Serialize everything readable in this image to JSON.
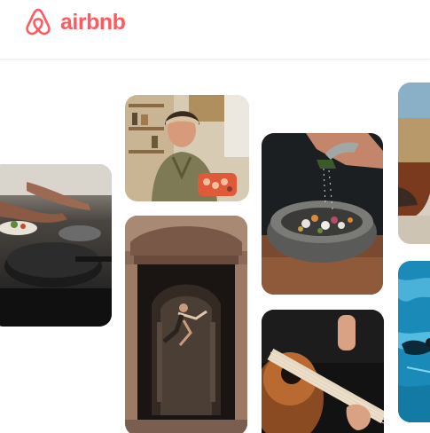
{
  "brand": {
    "name": "airbnb",
    "color": "#FF5A5F",
    "icon": "airbnb-belo-logo"
  },
  "gallery": {
    "tiles": [
      {
        "subject": "cooking-pan-tile"
      },
      {
        "subject": "chef-portrait-tile"
      },
      {
        "subject": "dancer-archway-tile"
      },
      {
        "subject": "stone-bowl-seasoning-tile"
      },
      {
        "subject": "guitar-player-tile"
      },
      {
        "subject": "street-partial-tile"
      },
      {
        "subject": "pool-swimmer-tile"
      }
    ]
  }
}
